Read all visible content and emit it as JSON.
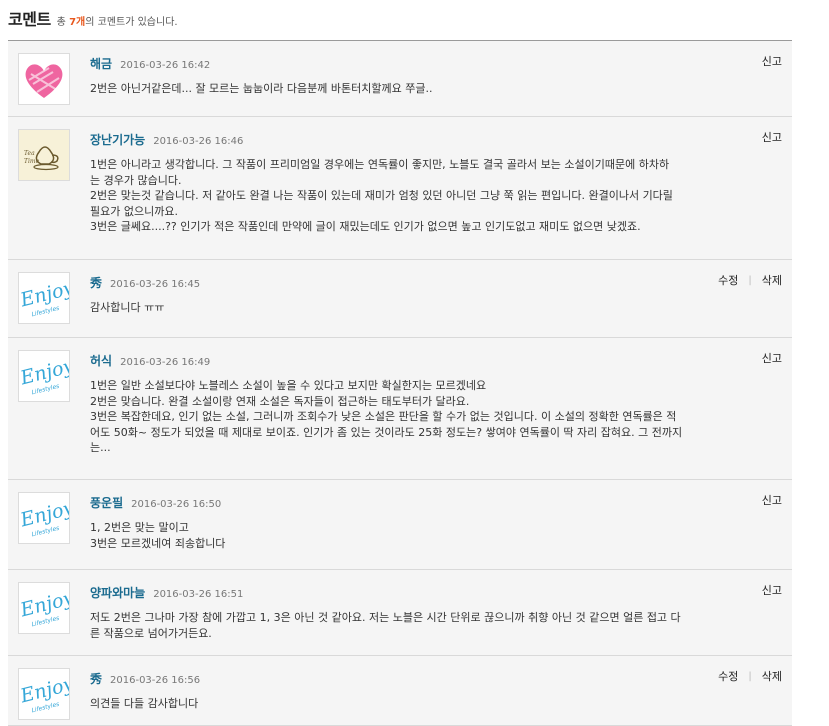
{
  "header": {
    "title": "코멘트",
    "summary_prefix": "총 ",
    "count": "7개",
    "summary_suffix": "의 코멘트가 있습니다."
  },
  "actions": {
    "report": "신고",
    "edit": "수정",
    "delete": "삭제",
    "separator": "|"
  },
  "comments": [
    {
      "author": "해금",
      "date": "2016-03-26 16:42",
      "avatar": "heart-icon",
      "lines": [
        "2번은 아닌거같은데... 잘 모르는 눕눕이라 다음분께 바톤터치할께요 쭈글.."
      ]
    },
    {
      "author": "장난기가능",
      "date": "2016-03-26 16:46",
      "avatar": "tea-cup-icon",
      "lines": [
        "1번은 아니라고 생각합니다. 그 작품이 프리미엄일 경우에는 연독률이 좋지만, 노블도 결국 골라서 보는 소설이기때문에 하차하",
        "는 경우가 많습니다.",
        "2번은 맞는것 같습니다. 저 같아도 완결 나는 작품이 있는데 재미가 엄청 있던 아니던 그냥 쭉 읽는 편입니다. 완결이나서 기다릴",
        "필요가 없으니까요.",
        "3번은 글쎄요....?? 인기가 적은 작품인데 만약에 글이 재밌는데도 인기가 없으면 높고 인기도없고 재미도 없으면 낮겠죠."
      ]
    },
    {
      "author": "秀",
      "date": "2016-03-26 16:45",
      "avatar": "enjoy-logo",
      "own": true,
      "lines": [
        "감사합니다 ㅠㅠ"
      ]
    },
    {
      "author": "허식",
      "date": "2016-03-26 16:49",
      "avatar": "enjoy-logo",
      "lines": [
        "1번은 일반 소설보다야 노블레스 소설이 높을 수 있다고 보지만 확실한지는 모르겠네요",
        "2번은 맞습니다. 완결 소설이랑 연재 소설은 독자들이 접근하는 태도부터가 달라요.",
        "3번은 복잡한데요, 인기 없는 소설, 그러니까 조회수가 낮은 소설은 판단을 할 수가 없는 것입니다. 이 소설의 정확한 연독률은 적",
        "어도 50화~ 정도가 되었을 때 제대로 보이죠. 인기가 좀 있는 것이라도 25화 정도는? 쌓여야 연독률이 딱 자리 잡혀요. 그 전까지",
        "는..."
      ]
    },
    {
      "author": "풍운필",
      "date": "2016-03-26 16:50",
      "avatar": "enjoy-logo",
      "lines": [
        "1, 2번은 맞는 말이고",
        "3번은 모르겠네여 죄송합니다"
      ]
    },
    {
      "author": "양파와마늘",
      "date": "2016-03-26 16:51",
      "avatar": "enjoy-logo",
      "lines": [
        "저도 2번은 그나마 가장 참에 가깝고 1, 3은 아닌 것 같아요. 저는 노블은 시간 단위로 끊으니까 취향 아닌 것 같으면 얼른 접고 다",
        "른 작품으로 넘어가거든요."
      ]
    },
    {
      "author": "秀",
      "date": "2016-03-26 16:56",
      "avatar": "enjoy-logo",
      "own": true,
      "lines": [
        "의견들 다들 감사합니다"
      ]
    }
  ],
  "enjoy_text": {
    "big": "Enjoy",
    "small": "Lifestyles"
  },
  "tea_text": {
    "line1": "Tea",
    "line2": "Time"
  },
  "colors": {
    "author": "#1b6b8f",
    "count": "#e8581e",
    "enjoy": "#35a7d8",
    "heart": "#ec4a8f"
  }
}
